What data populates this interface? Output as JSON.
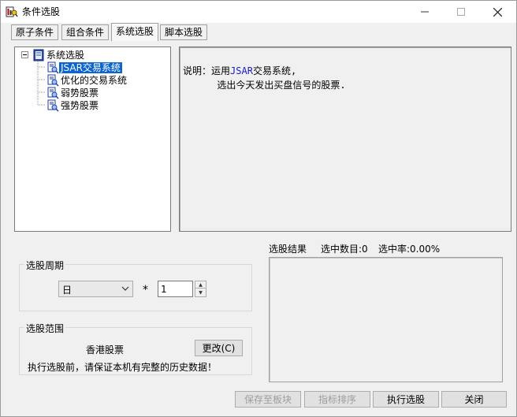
{
  "window": {
    "title": "条件选股",
    "icon": "stock-picker-app-icon",
    "controls": [
      "minimize-icon",
      "maximize-icon",
      "close-icon"
    ]
  },
  "tabs": [
    {
      "label": "原子条件",
      "active": false
    },
    {
      "label": "组合条件",
      "active": false
    },
    {
      "label": "系统选股",
      "active": true
    },
    {
      "label": "脚本选股",
      "active": false
    }
  ],
  "tree": {
    "root": "系统选股",
    "items": [
      {
        "label": "JSAR交易系统",
        "selected": true
      },
      {
        "label": "优化的交易系统",
        "selected": false
      },
      {
        "label": "弱势股票",
        "selected": false
      },
      {
        "label": "强势股票",
        "selected": false
      }
    ]
  },
  "description": {
    "prefix": "说明：",
    "line1_before": "运用",
    "line1_highlight": "JSAR",
    "line1_after": "交易系统,",
    "line2": "选出今天发出买盘信号的股票."
  },
  "period": {
    "title": "选股周期",
    "selected": "日",
    "multiplier_symbol": "*",
    "multiplier_value": "1"
  },
  "scope": {
    "title": "选股范围",
    "value": "香港股票",
    "change_button": "更改(C)",
    "notice": "执行选股前，请保证本机有完整的历史数据！"
  },
  "result": {
    "title": "选股结果",
    "count_label": "选中数目:0",
    "rate_label": "选中率:0.00%"
  },
  "buttons": {
    "save_to_block": "保存至板块",
    "indicator_sort": "指标排序",
    "execute": "执行选股",
    "close": "关闭"
  },
  "colors": {
    "selection": "#0a64d8",
    "highlight_text": "#1a1ad0",
    "window_bg": "#f0f0f0"
  }
}
